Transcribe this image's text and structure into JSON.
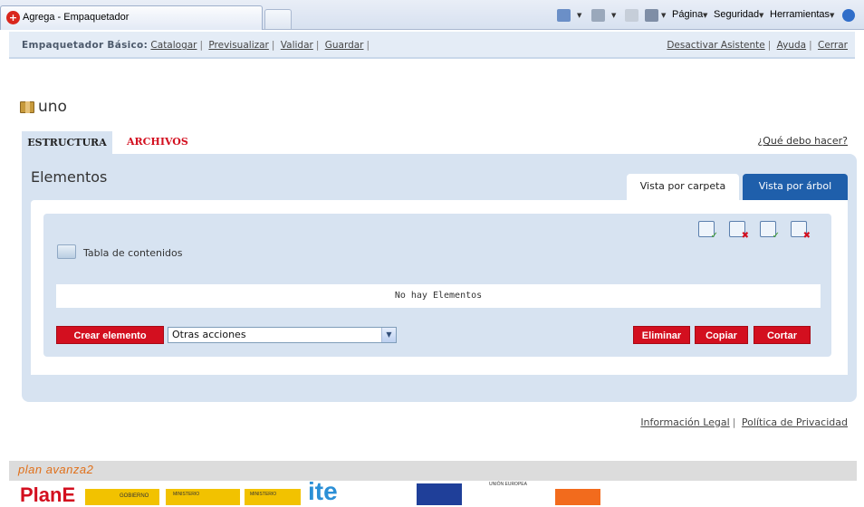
{
  "browser": {
    "tab_title": "Agrega - Empaquetador",
    "menu": [
      "Página",
      "Seguridad",
      "Herramientas"
    ]
  },
  "header": {
    "label": "Empaquetador Básico:",
    "links_left": [
      "Catalogar",
      "Previsualizar",
      "Validar",
      "Guardar"
    ],
    "links_right": [
      "Desactivar Asistente",
      "Ayuda",
      "Cerrar"
    ]
  },
  "page": {
    "title": "uno"
  },
  "tabs": {
    "estructura": "ESTRUCTURA",
    "archivos": "ARCHIVOS",
    "help": "¿Qué debo hacer?"
  },
  "panel": {
    "title": "Elementos",
    "view_folder": "Vista por carpeta",
    "view_tree": "Vista por árbol",
    "toc_label": "Tabla de contenidos",
    "empty_message": "No hay Elementos",
    "create_button": "Crear elemento",
    "other_actions": "Otras acciones",
    "delete_button": "Eliminar",
    "copy_button": "Copiar",
    "cut_button": "Cortar"
  },
  "footer": {
    "legal": "Información Legal",
    "privacy": "Política de Privacidad",
    "plan_avanza": "plan avanza2",
    "logos": {
      "plane": "PlanE",
      "gobierno": "GOBIERNO",
      "min1": "MINISTERIO",
      "min2": "MINISTERIO",
      "ite": "ite",
      "eu": "UNIÓN EUROPEA"
    }
  },
  "colors": {
    "accent_red": "#d30f1f",
    "panel_blue": "#d7e3f1",
    "tab_blue": "#1f5fab"
  }
}
